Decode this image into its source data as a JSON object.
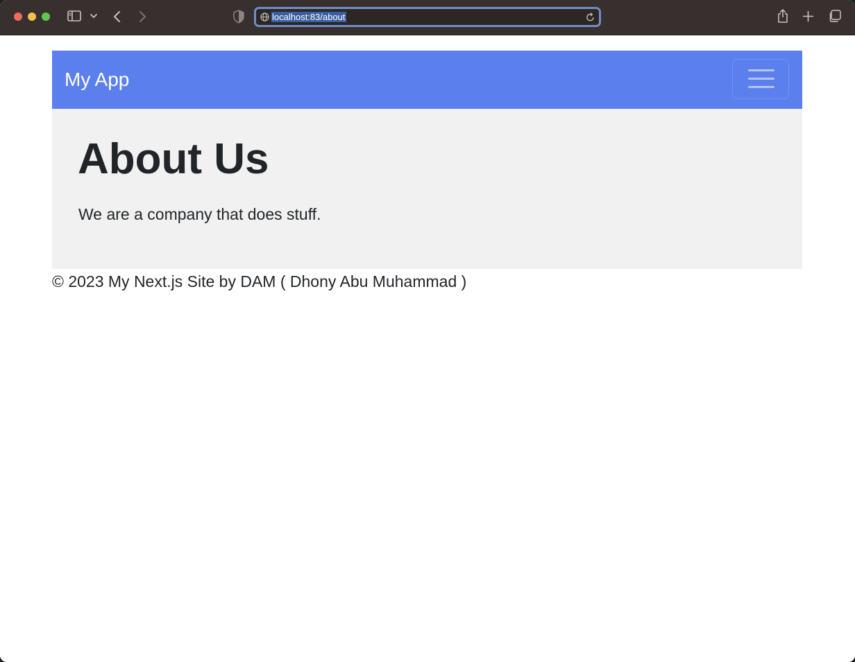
{
  "browser": {
    "url": "localhost:83/about"
  },
  "site": {
    "brand": "My App",
    "heading": "About Us",
    "paragraph": "We are a company that does stuff.",
    "footer": "© 2023 My Next.js Site by DAM ( Dhony Abu Muhammad )"
  },
  "icons": {
    "toolbar": [
      "sidebar-icon",
      "chevron-down-icon",
      "back-icon",
      "forward-icon",
      "shield-icon",
      "globe-icon",
      "reload-icon",
      "share-icon",
      "plus-icon",
      "tabs-icon"
    ],
    "navbar": [
      "hamburger-icon"
    ]
  },
  "colors": {
    "navbar_bg": "#5b7fec",
    "main_bg": "#f1f1f1",
    "text": "#212529",
    "toolbar_bg": "#38302f",
    "url_selection": "#3a5fa0"
  }
}
